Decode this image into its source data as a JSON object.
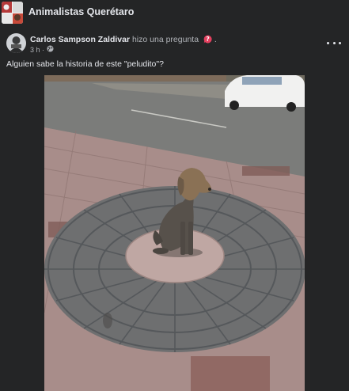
{
  "group": {
    "name": "Animalistas Querétaro",
    "thumb_text": "QRO"
  },
  "post": {
    "author": "Carlos Sampson Zaldivar",
    "action": "hizo una pregunta",
    "trailing": ".",
    "time": "3 h ·",
    "privacy_icon": "globe-icon",
    "more_icon": "more-dots-icon",
    "question_icon": "question-bubble-icon",
    "text": "Alguien sabe la historia de este \"peludito\"?",
    "photo": "bronze dog statue on circular stone paving"
  },
  "colors": {
    "background": "#242526",
    "primary_text": "#e4e6eb",
    "secondary_text": "#b0b3b8",
    "question_accent": "#e4405f"
  }
}
